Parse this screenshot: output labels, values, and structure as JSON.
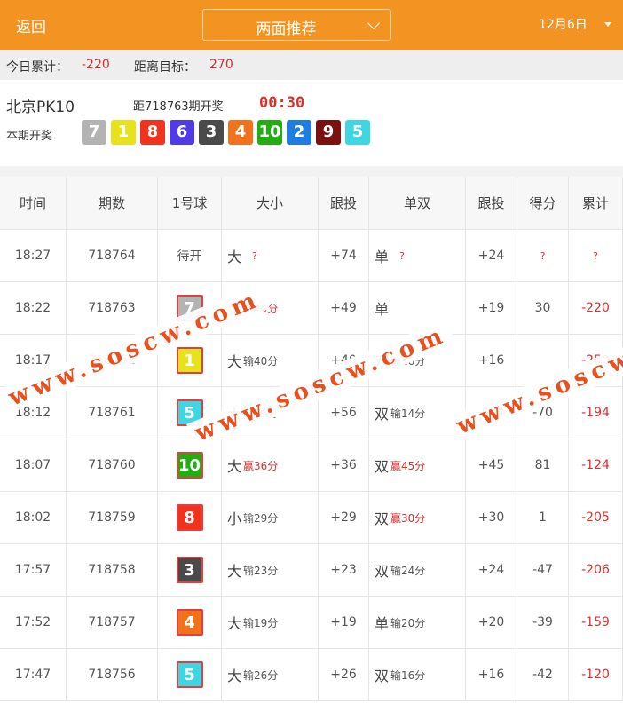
{
  "header": {
    "back_label": "返回",
    "dropdown_label": "两面推荐",
    "date_label": "12月6日"
  },
  "stats": {
    "today_label": "今日累计：",
    "today_value": "-220",
    "target_label": "距离目标：",
    "target_value": "270"
  },
  "lottery": {
    "name": "北京PK10",
    "issue_text": "距718763期开奖",
    "countdown": "00:30",
    "draw_label": "本期开奖",
    "balls": [
      {
        "num": "7",
        "color": "#b3b3b3"
      },
      {
        "num": "1",
        "color": "#e6e21c"
      },
      {
        "num": "8",
        "color": "#f2321c"
      },
      {
        "num": "6",
        "color": "#4f3ce8"
      },
      {
        "num": "3",
        "color": "#4a4a4a"
      },
      {
        "num": "4",
        "color": "#f2711c"
      },
      {
        "num": "10",
        "color": "#22ad13"
      },
      {
        "num": "2",
        "color": "#1f7de0"
      },
      {
        "num": "9",
        "color": "#7a1010"
      },
      {
        "num": "5",
        "color": "#3fd6e3"
      }
    ]
  },
  "table": {
    "headers": [
      "时间",
      "期数",
      "1号球",
      "大小",
      "跟投",
      "单双",
      "跟投",
      "得分",
      "累计"
    ],
    "rows": [
      {
        "time": "18:27",
        "period": "718764",
        "ball": "",
        "ball_text": "待开",
        "ball_color": "",
        "size": "大",
        "size_result": "?",
        "size_win": null,
        "follow1": "+74",
        "parity": "单",
        "parity_result": "?",
        "parity_win": null,
        "follow2": "+24",
        "score": "?",
        "total": "?"
      },
      {
        "time": "18:22",
        "period": "718763",
        "ball": "7",
        "ball_text": "",
        "ball_color": "#b3b3b3",
        "size": "大",
        "size_result": "赢49分",
        "size_win": true,
        "follow1": "+49",
        "parity": "单",
        "parity_result": "",
        "parity_win": null,
        "follow2": "+19",
        "score": "30",
        "total": "-220"
      },
      {
        "time": "18:17",
        "period": "718762",
        "ball": "1",
        "ball_text": "",
        "ball_color": "#e6e21c",
        "size": "大",
        "size_result": "输40分",
        "size_win": false,
        "follow1": "+40",
        "parity": "双",
        "parity_result": "输16分",
        "parity_win": false,
        "follow2": "+16",
        "score": "",
        "total": "-250"
      },
      {
        "time": "18:12",
        "period": "718761",
        "ball": "5",
        "ball_text": "",
        "ball_color": "#3fd6e3",
        "size": "大",
        "size_result": "输56分",
        "size_win": false,
        "follow1": "+56",
        "parity": "双",
        "parity_result": "输14分",
        "parity_win": false,
        "follow2": "+14",
        "score": "-70",
        "total": "-194"
      },
      {
        "time": "18:07",
        "period": "718760",
        "ball": "10",
        "ball_text": "",
        "ball_color": "#22ad13",
        "size": "大",
        "size_result": "赢36分",
        "size_win": true,
        "follow1": "+36",
        "parity": "双",
        "parity_result": "赢45分",
        "parity_win": true,
        "follow2": "+45",
        "score": "81",
        "total": "-124"
      },
      {
        "time": "18:02",
        "period": "718759",
        "ball": "8",
        "ball_text": "",
        "ball_color": "#f2321c",
        "size": "小",
        "size_result": "输29分",
        "size_win": false,
        "follow1": "+29",
        "parity": "双",
        "parity_result": "赢30分",
        "parity_win": true,
        "follow2": "+30",
        "score": "1",
        "total": "-205"
      },
      {
        "time": "17:57",
        "period": "718758",
        "ball": "3",
        "ball_text": "",
        "ball_color": "#4a4a4a",
        "size": "大",
        "size_result": "输23分",
        "size_win": false,
        "follow1": "+23",
        "parity": "双",
        "parity_result": "输24分",
        "parity_win": false,
        "follow2": "+24",
        "score": "-47",
        "total": "-206"
      },
      {
        "time": "17:52",
        "period": "718757",
        "ball": "4",
        "ball_text": "",
        "ball_color": "#f2711c",
        "size": "大",
        "size_result": "输19分",
        "size_win": false,
        "follow1": "+19",
        "parity": "单",
        "parity_result": "输20分",
        "parity_win": false,
        "follow2": "+20",
        "score": "-39",
        "total": "-159"
      },
      {
        "time": "17:47",
        "period": "718756",
        "ball": "5",
        "ball_text": "",
        "ball_color": "#3fd6e3",
        "size": "大",
        "size_result": "输26分",
        "size_win": false,
        "follow1": "+26",
        "parity": "双",
        "parity_result": "输16分",
        "parity_win": false,
        "follow2": "+16",
        "score": "-42",
        "total": "-120"
      }
    ]
  },
  "watermark": {
    "text": "www.soscw.com"
  },
  "colors": {
    "brand": "#f39422",
    "negative": "#d9302c"
  }
}
